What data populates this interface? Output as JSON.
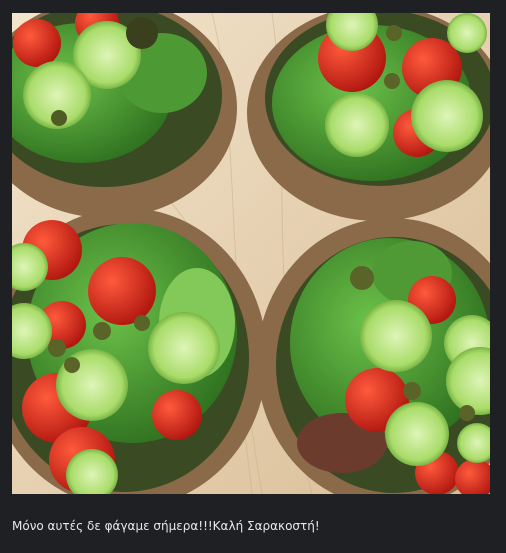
{
  "post": {
    "image_alt": "",
    "caption": "Μόνο αυτές δε φάγαμε σήμερα!!!Καλή Σαρακοστή!"
  },
  "colors": {
    "page_background": "#1e2023",
    "caption_text": "#e8e8e8",
    "wood": "#e9d7bd",
    "bread_crust": "#8a6a48",
    "lettuce": "#3d8a2a",
    "tomato": "#d2281e",
    "cucumber": "#b4e27a"
  }
}
